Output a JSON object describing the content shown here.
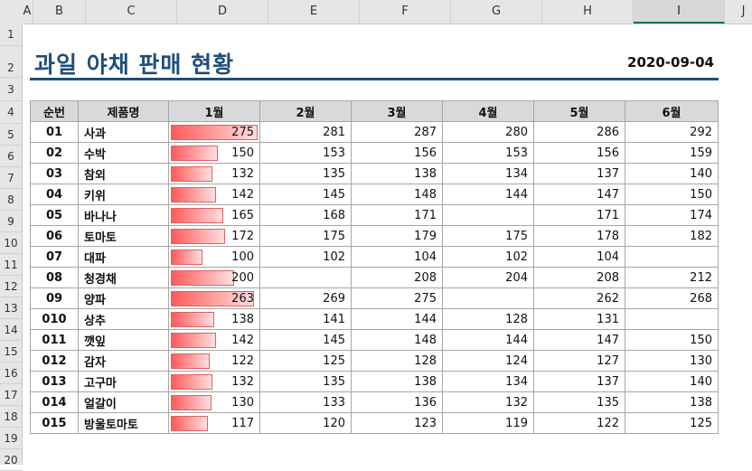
{
  "sheet": {
    "columns": [
      "A",
      "B",
      "C",
      "D",
      "E",
      "F",
      "G",
      "H",
      "I",
      "J"
    ],
    "selected_column": "I",
    "rows": [
      "1",
      "2",
      "3",
      "4",
      "5",
      "6",
      "7",
      "8",
      "9",
      "10",
      "11",
      "12",
      "13",
      "14",
      "15",
      "16",
      "17",
      "18",
      "19",
      "20"
    ]
  },
  "report": {
    "title": "과일 야채 판매 현황",
    "date": "2020-09-04"
  },
  "table": {
    "headers": [
      "순번",
      "제품명",
      "1월",
      "2월",
      "3월",
      "4월",
      "5월",
      "6월"
    ],
    "bar_max": 275,
    "rows": [
      {
        "no": "01",
        "name": "사과",
        "m": [
          "275",
          "281",
          "287",
          "280",
          "286",
          "292"
        ]
      },
      {
        "no": "02",
        "name": "수박",
        "m": [
          "150",
          "153",
          "156",
          "153",
          "156",
          "159"
        ]
      },
      {
        "no": "03",
        "name": "참외",
        "m": [
          "132",
          "135",
          "138",
          "134",
          "137",
          "140"
        ]
      },
      {
        "no": "04",
        "name": "키위",
        "m": [
          "142",
          "145",
          "148",
          "144",
          "147",
          "150"
        ]
      },
      {
        "no": "05",
        "name": "바나나",
        "m": [
          "165",
          "168",
          "171",
          "",
          "171",
          "174"
        ]
      },
      {
        "no": "06",
        "name": "토마토",
        "m": [
          "172",
          "175",
          "179",
          "175",
          "178",
          "182"
        ]
      },
      {
        "no": "07",
        "name": "대파",
        "m": [
          "100",
          "102",
          "104",
          "102",
          "104",
          ""
        ]
      },
      {
        "no": "08",
        "name": "청경채",
        "m": [
          "200",
          "",
          "208",
          "204",
          "208",
          "212"
        ]
      },
      {
        "no": "09",
        "name": "양파",
        "m": [
          "263",
          "269",
          "275",
          "",
          "262",
          "268"
        ]
      },
      {
        "no": "010",
        "name": "상추",
        "m": [
          "138",
          "141",
          "144",
          "128",
          "131",
          ""
        ]
      },
      {
        "no": "011",
        "name": "깻잎",
        "m": [
          "142",
          "145",
          "148",
          "144",
          "147",
          "150"
        ]
      },
      {
        "no": "012",
        "name": "감자",
        "m": [
          "122",
          "125",
          "128",
          "124",
          "127",
          "130"
        ]
      },
      {
        "no": "013",
        "name": "고구마",
        "m": [
          "132",
          "135",
          "138",
          "134",
          "137",
          "140"
        ]
      },
      {
        "no": "014",
        "name": "얼갈이",
        "m": [
          "130",
          "133",
          "136",
          "132",
          "135",
          "138"
        ]
      },
      {
        "no": "015",
        "name": "방울토마토",
        "m": [
          "117",
          "120",
          "123",
          "119",
          "122",
          "125"
        ]
      }
    ]
  }
}
